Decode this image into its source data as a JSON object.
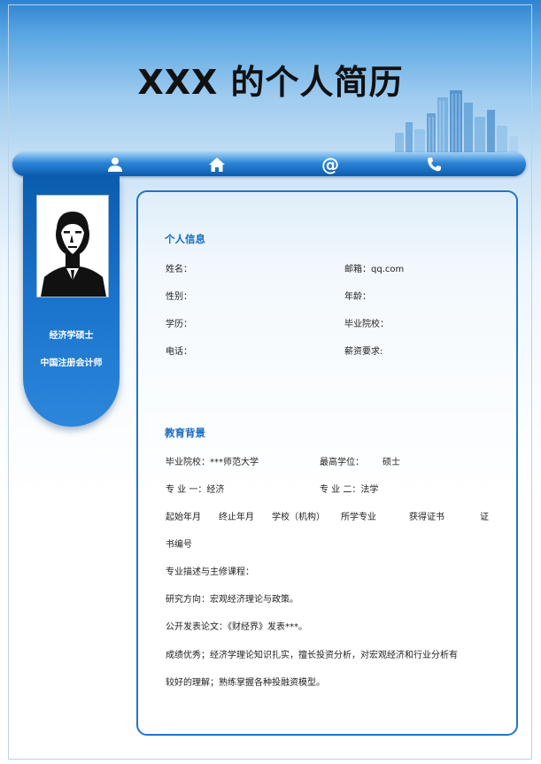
{
  "title": "XXX 的个人简历",
  "nav": {
    "icons": [
      "person-icon",
      "home-icon",
      "at-icon",
      "phone-icon"
    ],
    "at_glyph": "@"
  },
  "sidebar": {
    "degree": "经济学硕士",
    "cert": "中国注册会计师"
  },
  "personal": {
    "heading": "个人信息",
    "name_label": "姓名：",
    "gender_label": "性别：",
    "education_label": "学历：",
    "phone_label": "电话：",
    "email_label": "邮箱：qq.com",
    "age_label": "年龄：",
    "school_label": "毕业院校：",
    "salary_label": "薪资要求:"
  },
  "education": {
    "heading": "教育背景",
    "school": "毕业院校：***师范大学",
    "degree_label": "最高学位：",
    "degree_value": "硕士",
    "major1": "专 业 一：经济",
    "major2": "专 业 二：法学",
    "col_start": "起始年月",
    "col_end": "终止年月",
    "col_school": "学校（机构）",
    "col_major": "所学专业",
    "col_cert": "获得证书",
    "col_certno_1": "证",
    "col_certno_2": "书编号",
    "courses": "专业描述与主修课程：",
    "research": "研究方向：宏观经济理论与政策。",
    "paper": "公开发表论文：《财经界》发表***。",
    "grades_1": "成绩优秀；经济学理论知识扎实，擅长投资分析，对宏观经济和行业分析有",
    "grades_2": "较好的理解；熟练掌握各种投融资模型。"
  },
  "colors": {
    "accent": "#1a6cc2",
    "border": "#2076c6",
    "nav_dark": "#0b5cae"
  }
}
